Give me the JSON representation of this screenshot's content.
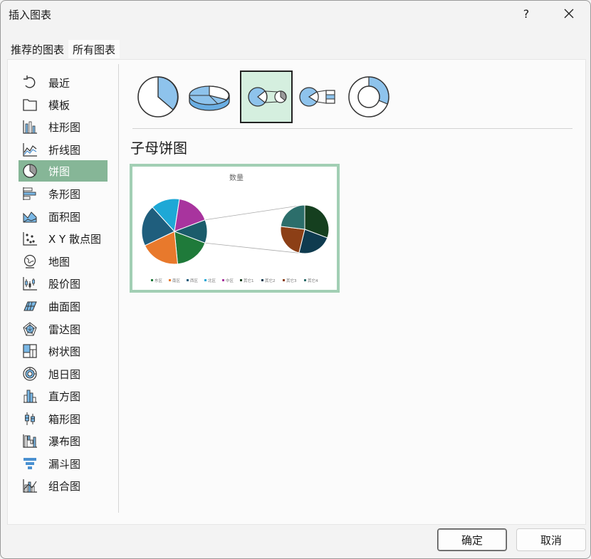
{
  "window": {
    "title": "插入图表",
    "help": "?"
  },
  "tabs": [
    {
      "label": "推荐的图表"
    },
    {
      "label": "所有图表",
      "active": true
    }
  ],
  "categories": [
    {
      "label": "最近",
      "icon": "recent-icon"
    },
    {
      "label": "模板",
      "icon": "folder-icon"
    },
    {
      "label": "柱形图",
      "icon": "column-chart-icon"
    },
    {
      "label": "折线图",
      "icon": "line-chart-icon"
    },
    {
      "label": "饼图",
      "icon": "pie-chart-icon",
      "selected": true
    },
    {
      "label": "条形图",
      "icon": "bar-chart-icon"
    },
    {
      "label": "面积图",
      "icon": "area-chart-icon"
    },
    {
      "label": "X Y 散点图",
      "icon": "scatter-chart-icon"
    },
    {
      "label": "地图",
      "icon": "map-chart-icon"
    },
    {
      "label": "股价图",
      "icon": "stock-chart-icon"
    },
    {
      "label": "曲面图",
      "icon": "surface-chart-icon"
    },
    {
      "label": "雷达图",
      "icon": "radar-chart-icon"
    },
    {
      "label": "树状图",
      "icon": "treemap-chart-icon"
    },
    {
      "label": "旭日图",
      "icon": "sunburst-chart-icon"
    },
    {
      "label": "直方图",
      "icon": "histogram-chart-icon"
    },
    {
      "label": "箱形图",
      "icon": "box-whisker-chart-icon"
    },
    {
      "label": "瀑布图",
      "icon": "waterfall-chart-icon"
    },
    {
      "label": "漏斗图",
      "icon": "funnel-chart-icon"
    },
    {
      "label": "组合图",
      "icon": "combo-chart-icon"
    }
  ],
  "subtypes": [
    {
      "icon": "pie-subtype-icon"
    },
    {
      "icon": "3d-pie-subtype-icon"
    },
    {
      "icon": "pie-of-pie-subtype-icon",
      "selected": true
    },
    {
      "icon": "bar-of-pie-subtype-icon"
    },
    {
      "icon": "doughnut-subtype-icon"
    }
  ],
  "chart_type_title": "子母饼图",
  "preview": {
    "chart_data": {
      "type": "pie",
      "title": "数量",
      "categories": [
        "东区",
        "南区",
        "西区",
        "北区",
        "中区",
        "其它1",
        "其它2",
        "其它3",
        "其它4"
      ],
      "main_values": [
        20,
        22,
        23,
        16,
        19
      ],
      "secondary_values": [
        4,
        3,
        3,
        3
      ],
      "main_colors": [
        "#1f7a3a",
        "#e8792c",
        "#1f5e7d",
        "#1ea8d6",
        "#a8349e",
        "#1b5c6b"
      ],
      "secondary_colors": [
        "#153f1f",
        "#0f3b4f",
        "#8c3f16",
        "#2c6e6b"
      ]
    }
  },
  "buttons": {
    "ok": "确定",
    "cancel": "取消"
  }
}
